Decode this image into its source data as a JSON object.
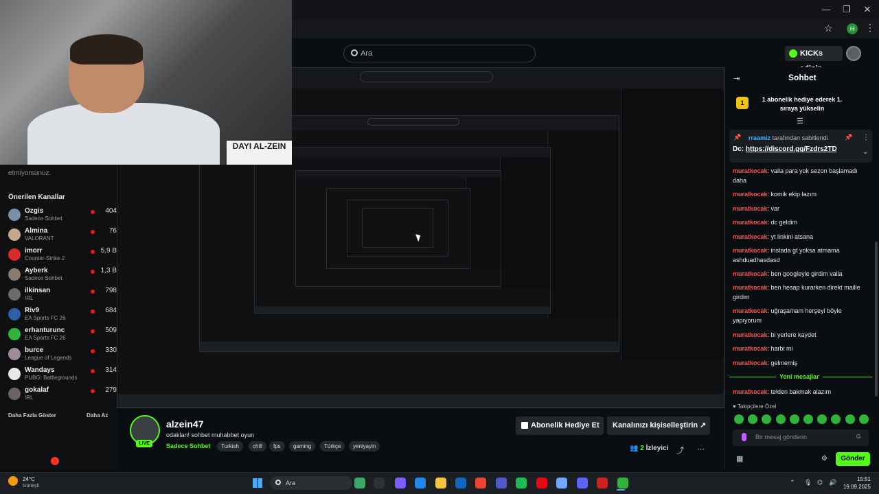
{
  "window": {
    "minimize": "—",
    "maximize": "❐",
    "close": "✕"
  },
  "browser": {
    "star": "☆",
    "profile": "H",
    "menu": "⋮"
  },
  "header": {
    "search_placeholder": "Ara",
    "kicks_button": "KICKs edinin"
  },
  "webcam": {
    "sign_text": "DAYI AL-ZEIN"
  },
  "sidebar": {
    "partial_text": "etmiyorsunuz.",
    "title": "Önerilen Kanallar",
    "channels": [
      {
        "name": "Ozgis",
        "game": "Sadece Sohbet",
        "viewers": "404",
        "color": "#7a8ea6"
      },
      {
        "name": "Almina",
        "game": "VALORANT",
        "viewers": "76",
        "color": "#c7a88a"
      },
      {
        "name": "imorr",
        "game": "Counter-Strike 2",
        "viewers": "5,9 B",
        "color": "#d92b2b"
      },
      {
        "name": "Ayberk",
        "game": "Sadece Sohbet",
        "viewers": "1,3 B",
        "color": "#8c7a6a"
      },
      {
        "name": "ilkinsan",
        "game": "IRL",
        "viewers": "798",
        "color": "#6e6a66"
      },
      {
        "name": "Riv9",
        "game": "EA Sports FC 26",
        "viewers": "684",
        "color": "#2f5fa8"
      },
      {
        "name": "erhanturunc",
        "game": "EA Sports FC 26",
        "viewers": "509",
        "color": "#2fb33a"
      },
      {
        "name": "burce",
        "game": "League of Legends",
        "viewers": "330",
        "color": "#a08c9a"
      },
      {
        "name": "Wandays",
        "game": "PUBG: Battlegrounds",
        "viewers": "314",
        "color": "#e8e8e8"
      },
      {
        "name": "gokalaf",
        "game": "IRL",
        "viewers": "279",
        "color": "#6a6560"
      }
    ],
    "show_more": "Daha Fazla Göster",
    "show_less": "Daha Az"
  },
  "stream": {
    "streamer": "alzein47",
    "live": "LIVE",
    "title": "odaklan! sohbet muhabbet oyun",
    "category": "Sadece Sohbet",
    "tags": [
      "Turkish",
      "chill",
      "fps",
      "gaming",
      "Türkçe",
      "yeniyayin"
    ],
    "subscribe_button": "Abonelik Hediye Et",
    "customize_button": "Kanalınızı kişiselleştirin",
    "viewer_count": "2",
    "viewer_label": "İzleyici"
  },
  "chat": {
    "title": "Sohbet",
    "goal_rank": "1",
    "goal_text": "1 abonelik hediye ederek 1. sıraya yükselin",
    "pinned_by_user": "rraamiz",
    "pinned_by_suffix": "tarafından sabitlendi",
    "pinned_prefix": "Dc: ",
    "pinned_link": "https://discord.gg/Fzdrs2TD",
    "messages": [
      {
        "user": "muratkocak",
        "text": ": valla para yok sezon başlamadı daha"
      },
      {
        "user": "muratkocak",
        "text": ": komik ekip lazım"
      },
      {
        "user": "muratkocak",
        "text": ": var"
      },
      {
        "user": "muratkocak",
        "text": ": dc geldim"
      },
      {
        "user": "muratkocak",
        "text": ": yt linkini atsana"
      },
      {
        "user": "muratkocak",
        "text": ": instada gt yoksa atmama ashduadhasdasd"
      },
      {
        "user": "muratkocak",
        "text": ": ben googleyle girdim valla"
      },
      {
        "user": "muratkocak",
        "text": ": ben hesap kurarken direkt maille girdim"
      },
      {
        "user": "muratkocak",
        "text": ": uğraşamam herşeyi böyle yapıyorum"
      },
      {
        "user": "muratkocak",
        "text": ": bi yerlere kaydet"
      },
      {
        "user": "muratkocak",
        "text": ": harbi mi"
      },
      {
        "user": "muratkocak",
        "text": ": gelmemiş"
      }
    ],
    "new_messages_label": "Yeni mesajlar",
    "new_message": {
      "user": "muratkocak",
      "text": ": telden bakmak alazım"
    },
    "emote_label": "Takipçilere Özel",
    "input_placeholder": "Bir mesaj gönderin",
    "send_button": "Gönder"
  },
  "taskbar": {
    "temperature": "24°C",
    "weather": "Güneşli",
    "search_placeholder": "Ara",
    "time": "15:51",
    "date": "19.09.2025"
  },
  "colors": {
    "kick_green": "#53fc18",
    "chat_user": "#ff4d4d",
    "live_dot": "#e91916"
  }
}
